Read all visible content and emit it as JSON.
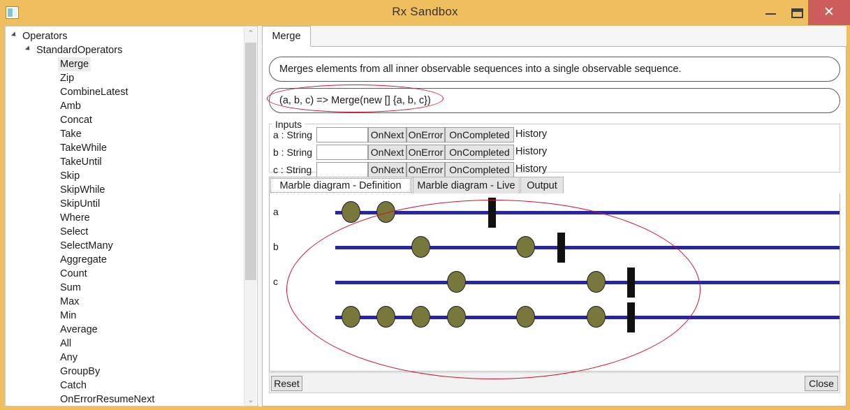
{
  "window": {
    "title": "Rx Sandbox",
    "app_icon": "app-icon",
    "minimize_label": "—",
    "maximize_label": "",
    "close_label": "✕",
    "titlebar_color": "#efbf5f",
    "close_button_color": "#cd5c5c"
  },
  "tree": {
    "root": {
      "label": "Operators",
      "expanded": true
    },
    "group": {
      "label": "StandardOperators",
      "expanded": true
    },
    "selected": "Merge",
    "items": [
      {
        "label": "Merge"
      },
      {
        "label": "Zip"
      },
      {
        "label": "CombineLatest"
      },
      {
        "label": "Amb"
      },
      {
        "label": "Concat"
      },
      {
        "label": "Take"
      },
      {
        "label": "TakeWhile"
      },
      {
        "label": "TakeUntil"
      },
      {
        "label": "Skip"
      },
      {
        "label": "SkipWhile"
      },
      {
        "label": "SkipUntil"
      },
      {
        "label": "Where"
      },
      {
        "label": "Select"
      },
      {
        "label": "SelectMany"
      },
      {
        "label": "Aggregate"
      },
      {
        "label": "Count"
      },
      {
        "label": "Sum"
      },
      {
        "label": "Max"
      },
      {
        "label": "Min"
      },
      {
        "label": "Average"
      },
      {
        "label": "All"
      },
      {
        "label": "Any"
      },
      {
        "label": "GroupBy"
      },
      {
        "label": "Catch"
      },
      {
        "label": "OnErrorResumeNext"
      }
    ],
    "scroll_up_glyph": "⌃",
    "scroll_down_glyph": "⌄"
  },
  "operator_tab": {
    "label": "Merge"
  },
  "description": "Merges elements from all inner observable sequences into a single observable sequence.",
  "expression": "(a, b, c) => Merge(new [] {a, b, c})",
  "inputs": {
    "legend": "Inputs",
    "onnext_label": "OnNext",
    "onerror_label": "OnError",
    "oncompleted_label": "OnCompleted",
    "history_label": "History",
    "rows": [
      {
        "label": "a : String",
        "value": "",
        "placeholder": ""
      },
      {
        "label": "b : String",
        "value": "",
        "placeholder": ""
      },
      {
        "label": "c : String",
        "value": "",
        "placeholder": ""
      }
    ]
  },
  "marble_tabs": [
    {
      "label": "Marble diagram - Definition",
      "active": true
    },
    {
      "label": "Marble diagram - Live",
      "active": false
    },
    {
      "label": "Output",
      "active": false
    }
  ],
  "diagram": {
    "line_color": "#26269e",
    "marble_color": "#78783c",
    "completed_color": "#111111",
    "rows": [
      {
        "label": "a",
        "marbles": [
          492,
          542
        ],
        "completed": 693
      },
      {
        "label": "b",
        "marbles": [
          592,
          742
        ],
        "completed": 792
      },
      {
        "label": "c",
        "marbles": [
          643,
          843
        ],
        "completed": 892
      },
      {
        "label": "",
        "marbles": [
          492,
          542,
          592,
          643,
          742,
          843
        ],
        "completed": 892
      }
    ]
  },
  "buttons": {
    "reset_label": "Reset",
    "close_label": "Close"
  },
  "annotations": {
    "color": "#cc1133",
    "ellipse_expression": "red ellipse around expression",
    "ellipse_diagram": "red ellipse around marble diagram"
  }
}
